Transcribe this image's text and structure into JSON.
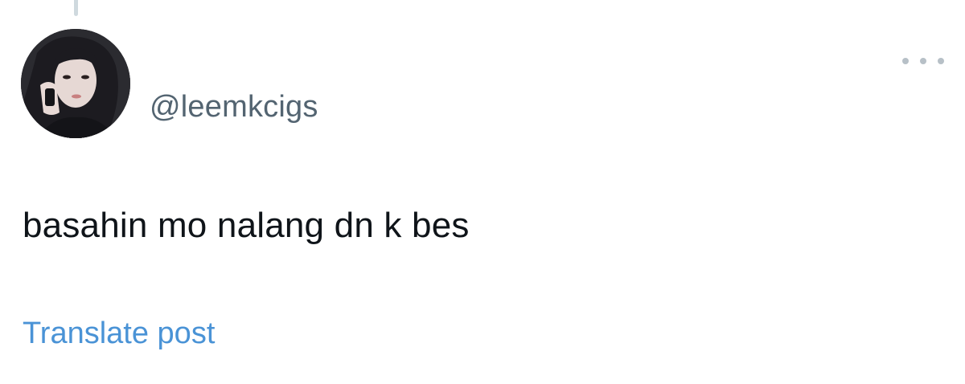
{
  "post": {
    "author_handle": "@leemkcigs",
    "avatar_icon": "profile-photo-avatar",
    "more_icon": "more-horizontal-icon",
    "text": "basahin mo nalang dn k bes",
    "translate_label": "Translate post"
  },
  "colors": {
    "handle": "#536471",
    "text": "#0f1419",
    "link": "#4a93d6",
    "thread_line": "#cfd9de"
  }
}
